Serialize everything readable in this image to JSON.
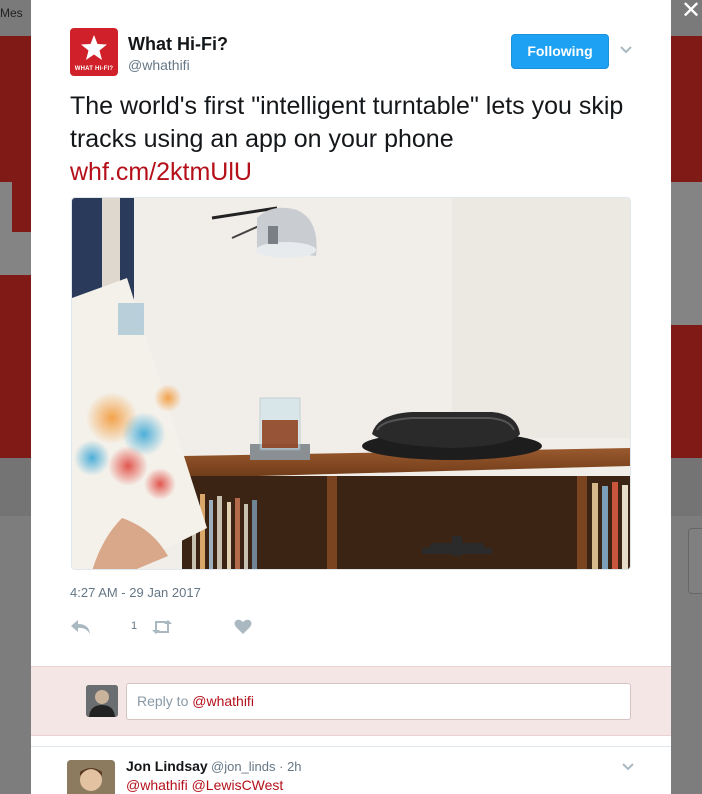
{
  "background": {
    "messages_label": "Mes",
    "close_glyph": "✕"
  },
  "tweet": {
    "author": {
      "name": "What Hi-Fi?",
      "handle": "@whathifi",
      "logo_text": "WHAT HI-FI?",
      "logo_icon": "star-icon"
    },
    "follow_button": "Following",
    "text": "The world's first \"intelligent turntable\" lets you skip tracks using an app on your phone",
    "link": "whf.cm/2ktmUlU",
    "timestamp": "4:27 AM - 29 Jan 2017",
    "actions": {
      "reply_count": "1",
      "reply_icon": "reply-icon",
      "retweet_icon": "retweet-icon",
      "like_icon": "heart-icon"
    }
  },
  "reply_box": {
    "placeholder_prefix": "Reply to ",
    "mention": "@whathifi"
  },
  "replies": [
    {
      "name": "Jon Lindsay",
      "handle": "@jon_linds",
      "time": "· 2h",
      "text": "@whathifi @LewisCWest"
    }
  ],
  "colors": {
    "accent": "#1da1f2",
    "brand": "#d0202a",
    "link": "#b5101a",
    "reply_bg": "#f5e6e6"
  }
}
